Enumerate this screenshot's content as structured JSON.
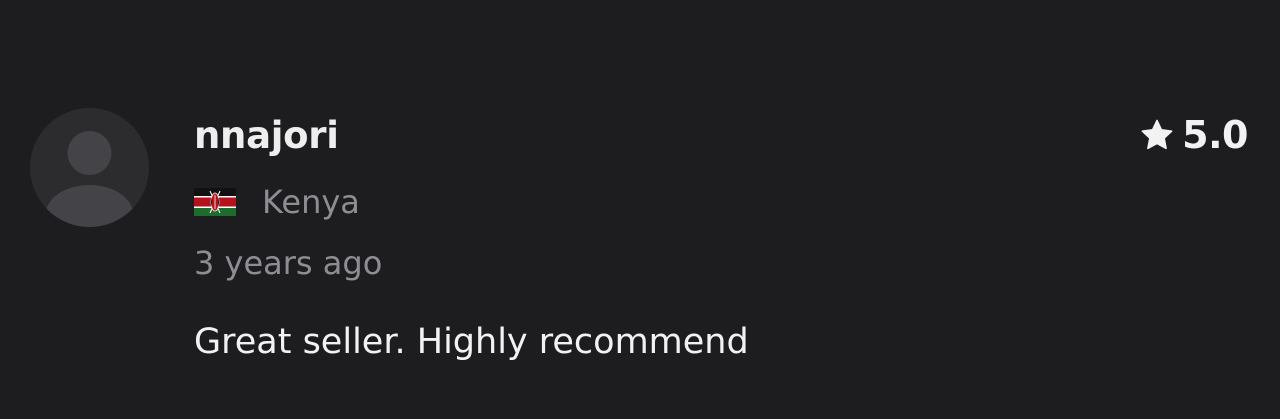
{
  "review": {
    "username": "nnajori",
    "rating": "5.0",
    "country": {
      "name": "Kenya",
      "flag_icon": "kenya-flag-icon"
    },
    "timestamp": "3 years ago",
    "text": "Great seller. Highly recommend",
    "avatar_icon": "default-user-avatar-icon",
    "rating_icon": "star-icon"
  },
  "colors": {
    "background": "#1d1d1f",
    "avatar_bg": "#2c2c2f",
    "avatar_glyph": "#444448",
    "primary_text": "#f2f2f3",
    "secondary_text": "#8d8d93"
  }
}
